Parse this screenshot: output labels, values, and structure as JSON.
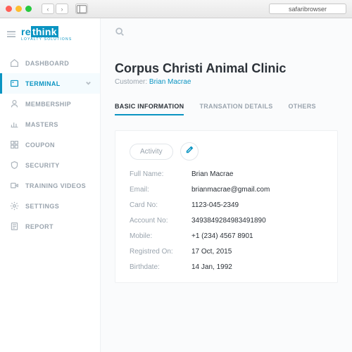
{
  "browser": {
    "address": "safaribrowser"
  },
  "brand": {
    "name_pre": "re",
    "name_box": "think",
    "tagline": "LOYALTY SOLUTIONS"
  },
  "sidebar": {
    "items": [
      {
        "label": "DASHBOARD"
      },
      {
        "label": "TERMINAL"
      },
      {
        "label": "MEMBERSHIP"
      },
      {
        "label": "MASTERS"
      },
      {
        "label": "COUPON"
      },
      {
        "label": "SECURITY"
      },
      {
        "label": "TRAINING VIDEOS"
      },
      {
        "label": "SETTINGS"
      },
      {
        "label": "REPORT"
      }
    ]
  },
  "page": {
    "title": "Corpus Christi Animal Clinic",
    "customer_label": "Customer:",
    "customer_name": "Brian Macrae"
  },
  "tabs": [
    {
      "label": "BASIC INFORMATION"
    },
    {
      "label": "TRANSATION DETAILS"
    },
    {
      "label": "OTHERS"
    }
  ],
  "card": {
    "activity_label": "Activity",
    "fields": [
      {
        "k": "Full Name:",
        "v": "Brian Macrae"
      },
      {
        "k": "Email:",
        "v": "brianmacrae@gmail.com"
      },
      {
        "k": "Card No:",
        "v": "1123-045-2349"
      },
      {
        "k": "Account No:",
        "v": "34938492849834918​90"
      },
      {
        "k": "Mobile:",
        "v": "+1 (234) 4567 8901"
      },
      {
        "k": "Registred On:",
        "v": "17 Oct, 2015"
      },
      {
        "k": "Birthdate:",
        "v": "14 Jan, 1992"
      }
    ]
  }
}
